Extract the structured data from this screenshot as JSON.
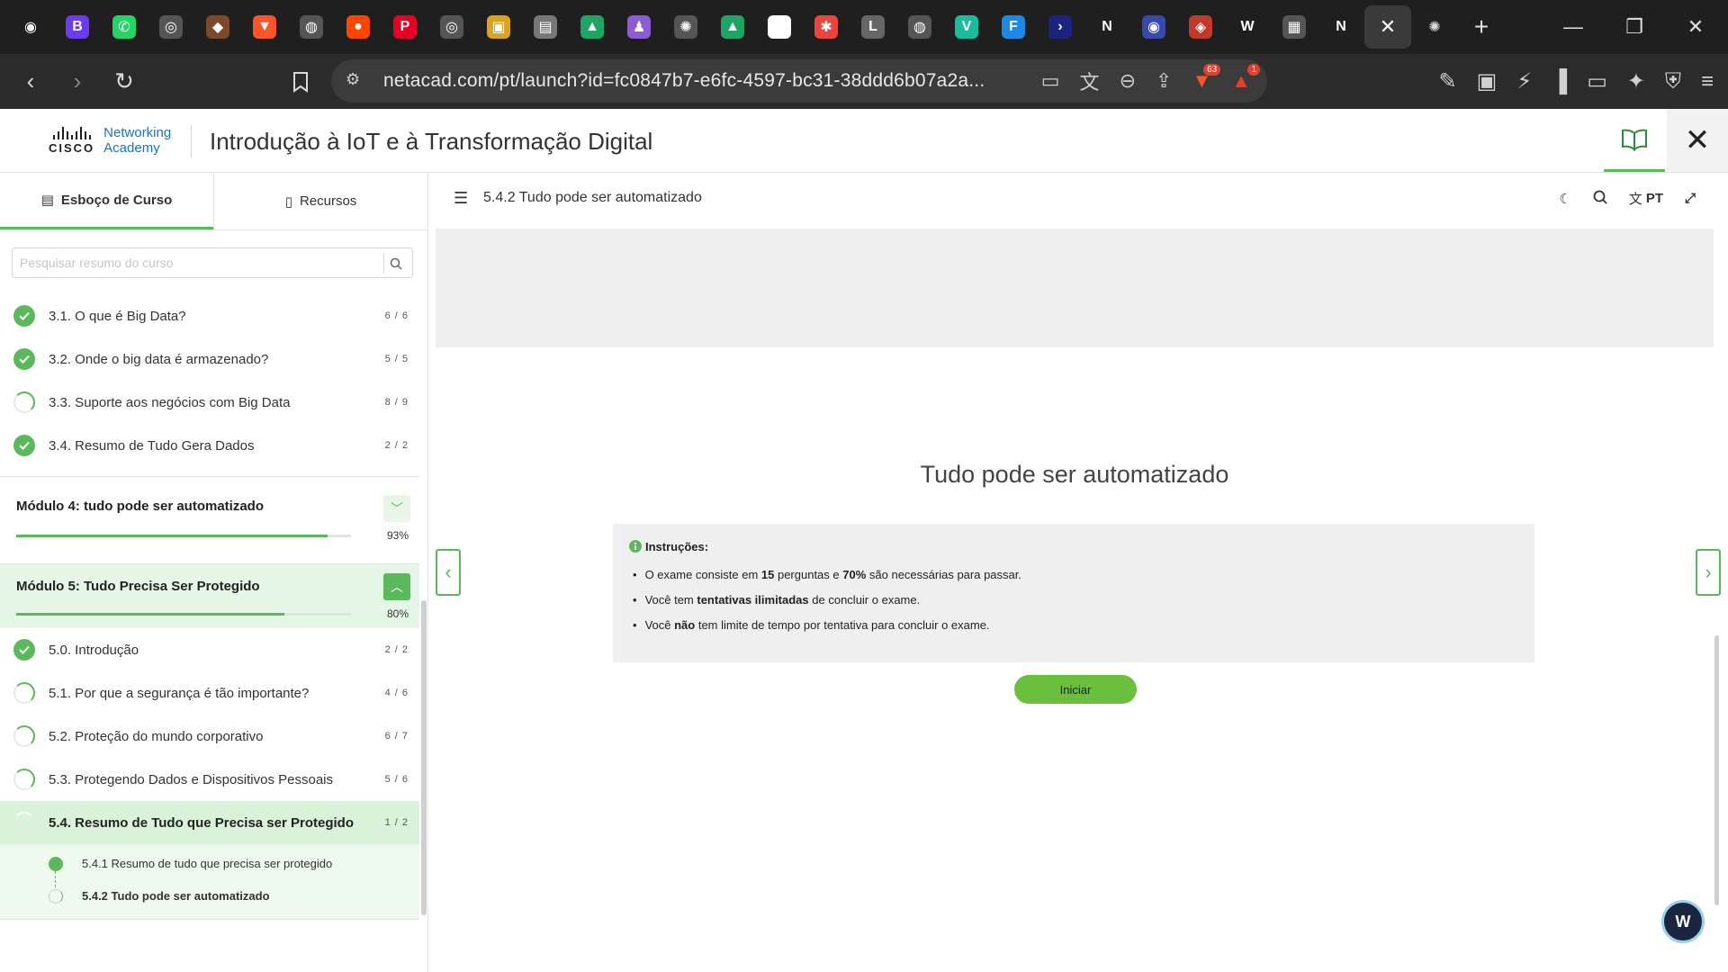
{
  "browser": {
    "tabs": [
      {
        "icon": "github-icon",
        "glyph": "◉",
        "color": "#1f1f1f"
      },
      {
        "icon": "b-app-icon",
        "glyph": "B",
        "color": "#6a3de8"
      },
      {
        "icon": "whatsapp-icon",
        "glyph": "✆",
        "color": "#25d366"
      },
      {
        "icon": "circle-app-icon",
        "glyph": "◎",
        "color": "#555555"
      },
      {
        "icon": "brave-icon",
        "glyph": "◆",
        "color": "#7a4a2a"
      },
      {
        "icon": "brave-shield-icon",
        "glyph": "▼",
        "color": "#fb542b"
      },
      {
        "icon": "globe-icon",
        "glyph": "◍",
        "color": "#555555"
      },
      {
        "icon": "reddit-icon",
        "glyph": "●",
        "color": "#ff4500"
      },
      {
        "icon": "pinterest-icon",
        "glyph": "P",
        "color": "#e60023"
      },
      {
        "icon": "circle-app-icon",
        "glyph": "◎",
        "color": "#555555"
      },
      {
        "icon": "image-app-icon",
        "glyph": "▣",
        "color": "#d9a520"
      },
      {
        "icon": "contact-icon",
        "glyph": "▤",
        "color": "#777777"
      },
      {
        "icon": "google-drive-icon",
        "glyph": "▲",
        "color": "#1fa463"
      },
      {
        "icon": "purple-app-icon",
        "glyph": "♟",
        "color": "#8e5bd6"
      },
      {
        "icon": "openai-icon",
        "glyph": "✺",
        "color": "#555555"
      },
      {
        "icon": "google-drive-icon",
        "glyph": "▲",
        "color": "#1fa463"
      },
      {
        "icon": "notion-icon",
        "glyph": "N",
        "color": "#ffffff"
      },
      {
        "icon": "multicolor-app-icon",
        "glyph": "✱",
        "color": "#e8453c"
      },
      {
        "icon": "l-app-icon",
        "glyph": "L",
        "color": "#666666"
      },
      {
        "icon": "globe-icon",
        "glyph": "◍",
        "color": "#555555"
      },
      {
        "icon": "v-app-icon",
        "glyph": "V",
        "color": "#1abc9c"
      },
      {
        "icon": "f-app-icon",
        "glyph": "F",
        "color": "#1e88e5"
      },
      {
        "icon": "terminal-icon",
        "glyph": "›",
        "color": "#1a237e"
      },
      {
        "icon": "n-app-icon",
        "glyph": "N",
        "color": "#1f1f1f"
      },
      {
        "icon": "wifi-signal-icon",
        "glyph": "◉",
        "color": "#3949ab"
      },
      {
        "icon": "shield-app-icon",
        "glyph": "◈",
        "color": "#c0392b"
      },
      {
        "icon": "w-app-icon",
        "glyph": "W",
        "color": "#1f1f1f"
      },
      {
        "icon": "pc-app-icon",
        "glyph": "▦",
        "color": "#555555"
      },
      {
        "icon": "n-app-icon",
        "glyph": "N",
        "color": "#1f1f1f"
      }
    ],
    "url": "netacad.com/pt/launch?id=fc0847b7-e6fc-4597-bc31-38ddd6b07a2a...",
    "shield_badge": "63",
    "alert_badge": "1"
  },
  "header": {
    "logo_line1": "Networking",
    "logo_line2": "Academy",
    "logo_word": "CISCO",
    "course_title": "Introdução à IoT e à Transformação Digital"
  },
  "sidebar": {
    "tab_outline": "Esboço de Curso",
    "tab_resources": "Recursos",
    "search_placeholder": "Pesquisar resumo do curso",
    "items_top": [
      {
        "label": "3.1. O que é Big Data?",
        "count": "6 / 6",
        "status": "complete"
      },
      {
        "label": "3.2. Onde o big data é armazenado?",
        "count": "5 / 5",
        "status": "complete"
      },
      {
        "label": "3.3. Suporte aos negócios com Big Data",
        "count": "8 / 9",
        "status": "partial"
      },
      {
        "label": "3.4. Resumo de Tudo Gera Dados",
        "count": "2 / 2",
        "status": "complete"
      }
    ],
    "module4": {
      "title": "Módulo 4: tudo pode ser automatizado",
      "percent": "93%",
      "progress": 0.93
    },
    "module5": {
      "title": "Módulo 5: Tudo Precisa Ser Protegido",
      "percent": "80%",
      "progress": 0.8
    },
    "items_m5": [
      {
        "label": "5.0. Introdução",
        "count": "2 / 2",
        "status": "complete"
      },
      {
        "label": "5.1. Por que a segurança é tão importante?",
        "count": "4 / 6",
        "status": "partial"
      },
      {
        "label": "5.2. Proteção do mundo corporativo",
        "count": "6 / 7",
        "status": "partial"
      },
      {
        "label": "5.3. Protegendo Dados e Dispositivos Pessoais",
        "count": "5 / 6",
        "status": "partial"
      }
    ],
    "current": {
      "label": "5.4. Resumo de Tudo que Precisa ser Protegido",
      "count": "1 / 2"
    },
    "sub_items": [
      {
        "label": "5.4.1 Resumo de tudo que precisa ser protegido",
        "status": "complete"
      },
      {
        "label": "5.4.2 Tudo pode ser automatizado",
        "status": "current"
      }
    ]
  },
  "content": {
    "breadcrumb_title": "5.4.2 Tudo pode ser automatizado",
    "language": "PT",
    "heading": "Tudo pode ser automatizado",
    "instructions_label": "Instruções:",
    "line1": {
      "a": "O exame consiste em ",
      "b": "15",
      "c": " perguntas e ",
      "d": "70%",
      "e": " são necessárias para passar."
    },
    "line2": {
      "a": "Você tem ",
      "b": "tentativas ilimitadas",
      "c": " de concluir o exame."
    },
    "line3": {
      "a": "Você ",
      "b": "não",
      "c": " tem limite de tempo por tentativa para concluir o exame."
    },
    "start_button": "Iniciar"
  },
  "colors": {
    "accent": "#5cb85c",
    "start_button": "#6abf3f",
    "link_blue": "#1a74c0"
  }
}
